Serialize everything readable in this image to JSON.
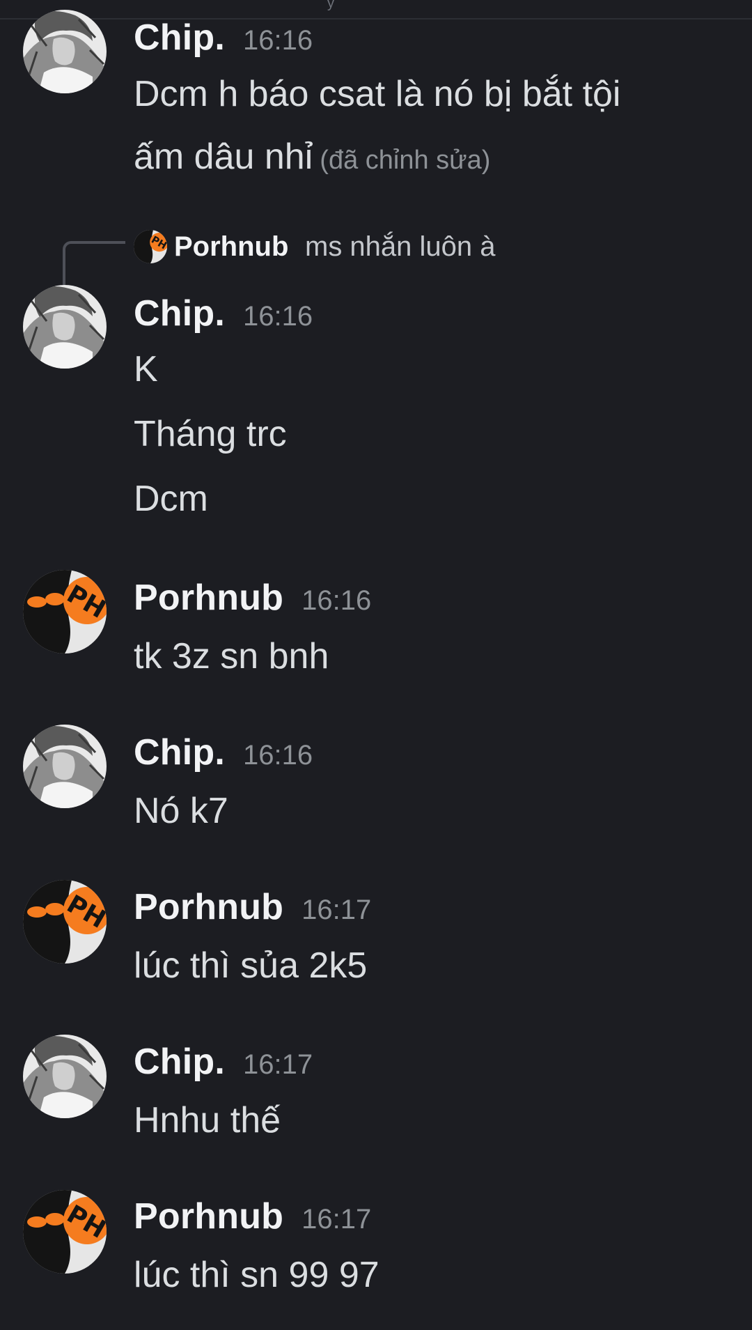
{
  "top": {
    "cut_text": "y"
  },
  "messages": [
    {
      "author": "Chip.",
      "time": "16:16",
      "lines": [
        "Dcm h báo csat là nó bị bắt tội",
        "ấm dâu nhỉ"
      ],
      "edited_label": "(đã chỉnh sửa)"
    },
    {
      "reply": {
        "author": "Porhnub",
        "text": "ms nhắn luôn à"
      },
      "author": "Chip.",
      "time": "16:16",
      "lines": [
        "K",
        "Tháng trc",
        "Dcm"
      ]
    },
    {
      "author": "Porhnub",
      "time": "16:16",
      "lines": [
        "tk 3z sn bnh"
      ]
    },
    {
      "author": "Chip.",
      "time": "16:16",
      "lines": [
        "Nó k7"
      ]
    },
    {
      "author": "Porhnub",
      "time": "16:17",
      "lines": [
        "lúc thì sủa 2k5"
      ]
    },
    {
      "author": "Chip.",
      "time": "16:17",
      "lines": [
        "Hnhu thế"
      ]
    },
    {
      "author": "Porhnub",
      "time": "16:17",
      "lines": [
        "lúc thì sn 99 97"
      ]
    }
  ],
  "colors": {
    "background": "#1c1d22",
    "username": "#f2f3f5",
    "timestamp": "#8e9297",
    "message_text": "#dbdee1",
    "avatar_badge": "#f57c1f"
  },
  "icons": {
    "chip_avatar": "anime-portrait-avatar",
    "porhnub_avatar": "hooded-figure-ph-avatar"
  }
}
